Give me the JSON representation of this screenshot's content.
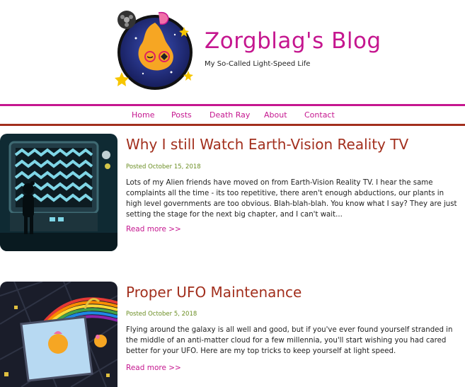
{
  "site": {
    "title": "Zorgblag's Blog",
    "tagline": "My So-Called Light-Speed Life"
  },
  "nav": {
    "items": [
      "Home",
      "Posts",
      "Death Ray",
      "About",
      "Contact"
    ]
  },
  "colors": {
    "accent": "#c5168f",
    "title": "#a22f1d",
    "date": "#6b8e23"
  },
  "posts": [
    {
      "title": "Why I still Watch Earth-Vision Reality TV",
      "date": "Posted October 15, 2018",
      "excerpt": "Lots of my Alien friends have moved on from Earth-Vision Reality TV. I hear the same complaints all the time - its too repetitive, there aren't enough abductions, our plants in high level governments are too obvious. Blah-blah-blah. You know what I say? They are just setting the stage for the next big chapter, and I can't wait...",
      "read_more": "Read more >>",
      "image_icon": "tv-alien-illustration"
    },
    {
      "title": "Proper UFO Maintenance",
      "date": "Posted October 5, 2018",
      "excerpt": "Flying around the galaxy is all well and good, but if you've ever found yourself stranded in the middle of an anti-matter cloud for a few millennia, you'll start wishing you had cared better for your UFO. Here are my top tricks to keep yourself at light speed.",
      "read_more": "Read more >>",
      "image_icon": "ufo-space-illustration"
    }
  ]
}
